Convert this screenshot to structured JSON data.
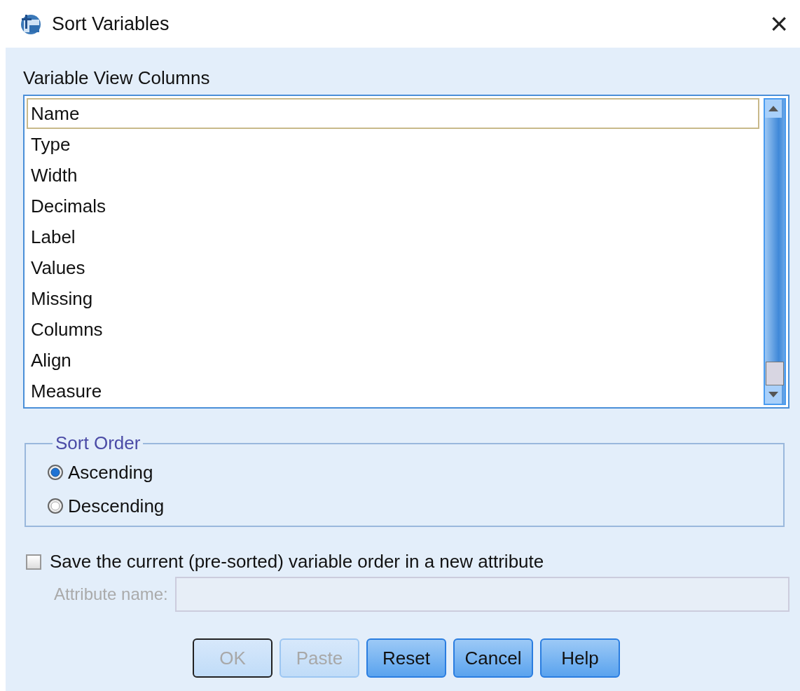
{
  "window": {
    "title": "Sort Variables",
    "close": "×"
  },
  "list": {
    "label": "Variable View Columns",
    "items": [
      {
        "text": "Name",
        "selected": true
      },
      {
        "text": "Type",
        "selected": false
      },
      {
        "text": "Width",
        "selected": false
      },
      {
        "text": "Decimals",
        "selected": false
      },
      {
        "text": "Label",
        "selected": false
      },
      {
        "text": "Values",
        "selected": false
      },
      {
        "text": "Missing",
        "selected": false
      },
      {
        "text": "Columns",
        "selected": false
      },
      {
        "text": "Align",
        "selected": false
      },
      {
        "text": "Measure",
        "selected": false
      }
    ]
  },
  "sort_order": {
    "title": "Sort Order",
    "options": [
      {
        "label": "Ascending",
        "selected": true
      },
      {
        "label": "Descending",
        "selected": false
      }
    ]
  },
  "save_order": {
    "label": "Save the current (pre-sorted) variable order in a new attribute",
    "checked": false
  },
  "attribute_name": {
    "label": "Attribute name:",
    "disabled": true
  },
  "buttons": [
    {
      "label": "OK",
      "disabled": true,
      "default": true
    },
    {
      "label": "Paste",
      "disabled": true,
      "default": false
    },
    {
      "label": "Reset",
      "disabled": false,
      "default": false
    },
    {
      "label": "Cancel",
      "disabled": false,
      "default": false
    },
    {
      "label": "Help",
      "disabled": false,
      "default": false
    }
  ]
}
